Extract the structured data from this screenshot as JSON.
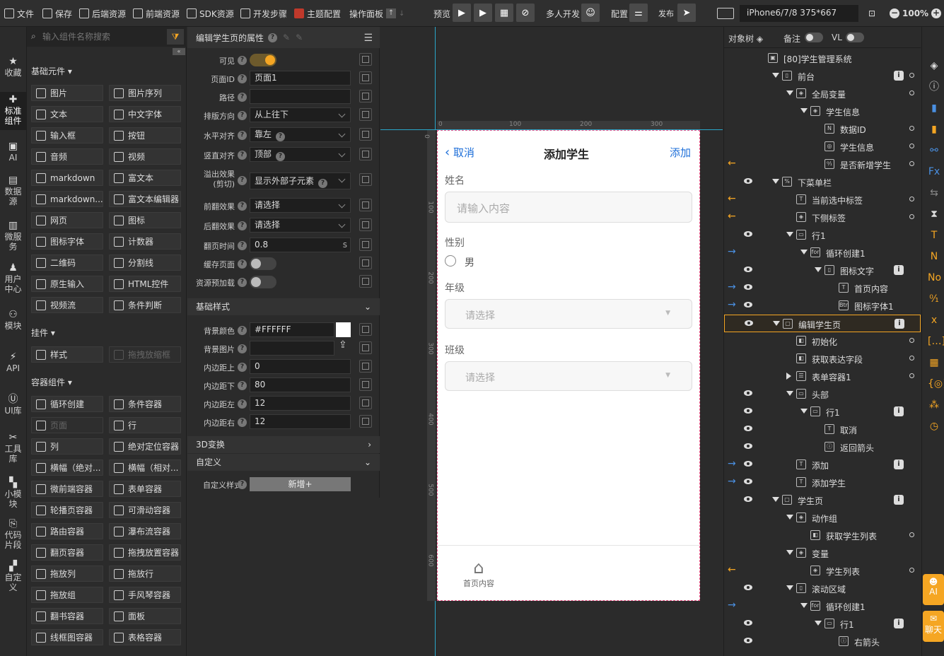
{
  "toolbar": {
    "file": "文件",
    "save": "保存",
    "backend": "后端资源",
    "frontend": "前端资源",
    "sdk": "SDK资源",
    "steps": "开发步骤",
    "theme": "主题配置",
    "panel": "操作面板",
    "preview": "预览",
    "multi_dev": "多人开发",
    "config": "配置",
    "publish": "发布",
    "device": "iPhone6/7/8 375*667",
    "zoom": "100%"
  },
  "iconbar": [
    "收藏",
    "标准组件",
    "AI",
    "数据源",
    "微服务",
    "用户中心",
    "模块",
    "API",
    "UI库",
    "工具库",
    "小模块",
    "代码片段",
    "自定义"
  ],
  "components": {
    "search_placeholder": "输入组件名称搜索",
    "sections": {
      "basic": "基础元件",
      "plugin": "挂件",
      "container": "容器组件"
    },
    "basic": [
      "图片",
      "图片序列",
      "文本",
      "中文字体",
      "输入框",
      "按钮",
      "音频",
      "视频",
      "markdown",
      "富文本",
      "markdown...",
      "富文本编辑器",
      "网页",
      "图标",
      "图标字体",
      "计数器",
      "二维码",
      "分割线",
      "原生输入",
      "HTML控件",
      "视频流",
      "条件判断"
    ],
    "plugin": [
      "样式",
      "拖拽放缩框"
    ],
    "container": [
      "循环创建",
      "条件容器",
      "页面",
      "行",
      "列",
      "绝对定位容器",
      "横幅（绝对...",
      "横幅（相对...",
      "微前端容器",
      "表单容器",
      "轮播页容器",
      "可滑动容器",
      "路由容器",
      "瀑布流容器",
      "翻页容器",
      "拖拽放置容器",
      "拖放列",
      "拖放行",
      "拖放组",
      "手风琴容器",
      "翻书容器",
      "面板",
      "线框图容器",
      "表格容器"
    ]
  },
  "props": {
    "title": "编辑学生页的属性",
    "visible": "可见",
    "page_id_label": "页面ID",
    "page_id": "页面1",
    "path_label": "路径",
    "path": "",
    "direction_label": "排版方向",
    "direction": "从上往下",
    "halign_label": "水平对齐",
    "halign": "靠左",
    "valign_label": "竖直对齐",
    "valign": "顶部",
    "overflow_label1": "溢出效果",
    "overflow_label2": "(剪切)",
    "overflow": "显示外部子元素",
    "front_label": "前翻效果",
    "front": "请选择",
    "back_label": "后翻效果",
    "back": "请选择",
    "flip_label": "翻页时间",
    "flip": "0.8",
    "flip_unit": "s",
    "cache_label": "缓存页面",
    "preload_label": "资源预加载",
    "style_section": "基础样式",
    "bg_color_label": "背景颜色",
    "bg_color": "#FFFFFF",
    "bg_image_label": "背景图片",
    "pad_top_label": "内边距上",
    "pad_top": "0",
    "pad_bottom_label": "内边距下",
    "pad_bottom": "80",
    "pad_left_label": "内边距左",
    "pad_left": "12",
    "pad_right_label": "内边距右",
    "pad_right": "12",
    "t3d": "3D变换",
    "custom": "自定义",
    "custom_style_label": "自定义样式",
    "add": "新增+"
  },
  "ruler": {
    "h": [
      "0",
      "100",
      "200",
      "300"
    ],
    "v": [
      "0",
      "100",
      "200",
      "300",
      "400",
      "500",
      "600"
    ]
  },
  "phone": {
    "cancel": "取消",
    "title": "添加学生",
    "add": "添加",
    "name_label": "姓名",
    "name_placeholder": "请输入内容",
    "gender_label": "性别",
    "gender_option": "男",
    "grade_label": "年级",
    "grade_placeholder": "请选择",
    "class_label": "班级",
    "class_placeholder": "请选择",
    "tab_home": "首页内容"
  },
  "tree": {
    "tab_objects": "对象树",
    "tab_notes": "备注",
    "tab_vl": "VL",
    "rows": [
      "[80]学生管理系统",
      "前台",
      "全局变量",
      "学生信息",
      "数据ID",
      "学生信息",
      "是否新增学生",
      "下菜单栏",
      "当前选中标签",
      "下侧标签",
      "行1",
      "循环创建1",
      "图标文字",
      "首页内容",
      "图标字体1",
      "编辑学生页",
      "初始化",
      "获取表达字段",
      "表单容器1",
      "头部",
      "行1",
      "取消",
      "返回箭头",
      "添加",
      "添加学生",
      "学生页",
      "动作组",
      "获取学生列表",
      "变量",
      "学生列表",
      "滚动区域",
      "循环创建1",
      "行1",
      "右箭头"
    ]
  },
  "rightbar": {
    "ai": "AI",
    "chat": "聊天"
  }
}
